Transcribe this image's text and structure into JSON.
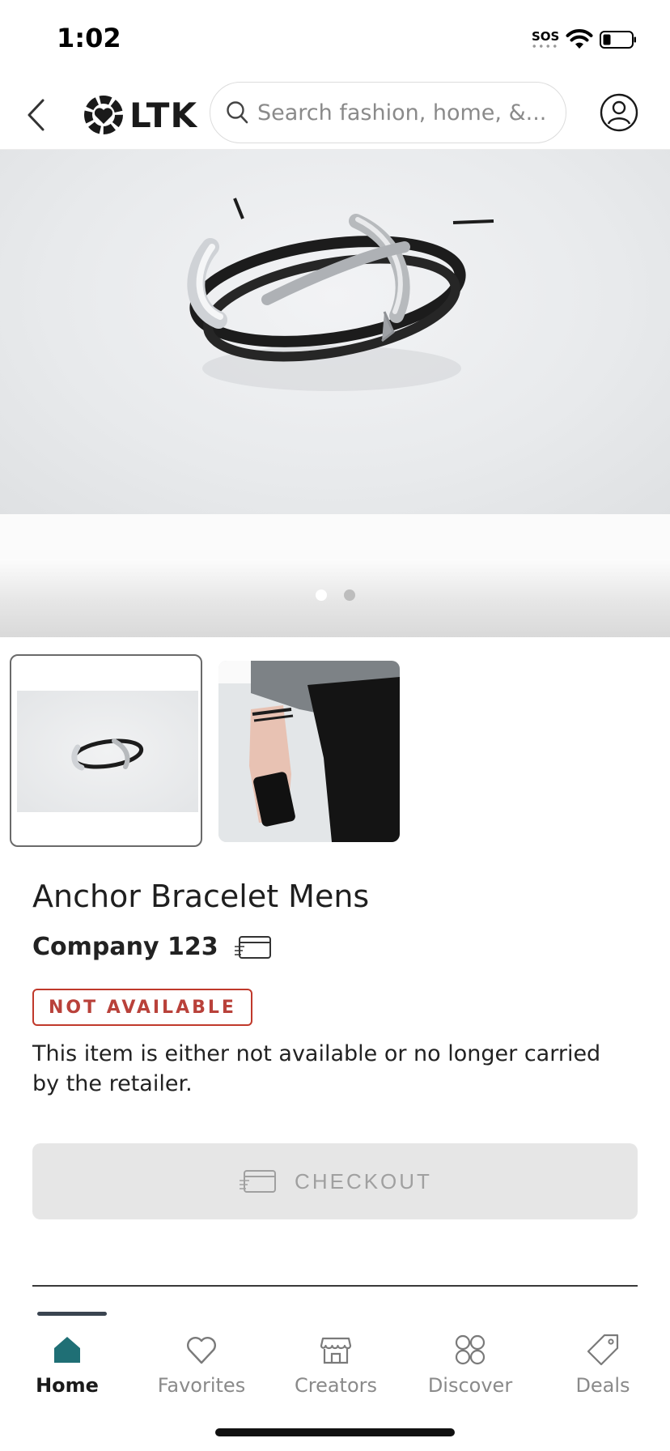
{
  "status_bar": {
    "time": "1:02",
    "sos": "SOS"
  },
  "header": {
    "logo_text": "LTK",
    "search_placeholder": "Search fashion, home, &..."
  },
  "product": {
    "title": "Anchor Bracelet Mens",
    "brand": "Company 123",
    "status_badge": "NOT AVAILABLE",
    "availability_note": "This item is either not available or no longer carried by the retailer.",
    "checkout_label": "CHECKOUT",
    "image_count": 2,
    "active_image": 1
  },
  "bottom_nav": {
    "items": [
      {
        "label": "Home",
        "icon": "home-icon",
        "active": true
      },
      {
        "label": "Favorites",
        "icon": "heart-icon",
        "active": false
      },
      {
        "label": "Creators",
        "icon": "storefront-icon",
        "active": false
      },
      {
        "label": "Discover",
        "icon": "grid-icon",
        "active": false
      },
      {
        "label": "Deals",
        "icon": "tag-icon",
        "active": false
      }
    ]
  },
  "colors": {
    "accent": "#1f6f75",
    "badge_red": "#b9413a",
    "checkout_disabled_bg": "#e6e6e6"
  }
}
